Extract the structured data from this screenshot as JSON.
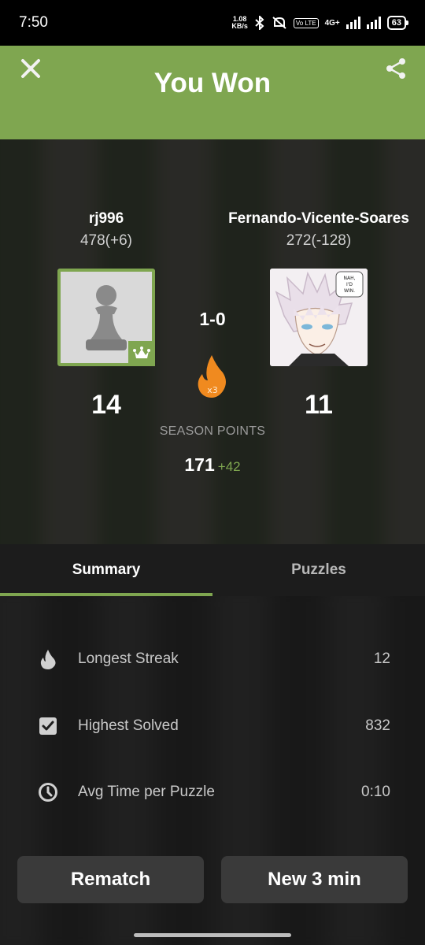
{
  "status_bar": {
    "time": "7:50",
    "speed": "1.08",
    "speed_unit": "KB/s",
    "network": "4G+",
    "battery": "63"
  },
  "header": {
    "title": "You Won"
  },
  "players": {
    "left": {
      "name": "rj996",
      "rating": "478(+6)",
      "points": "14"
    },
    "right": {
      "name": "Fernando-Vicente-Soares",
      "rating": "272(-128)",
      "points": "11"
    }
  },
  "match": {
    "score": "1-0",
    "streak_multiplier": "x3"
  },
  "season": {
    "label": "SEASON POINTS",
    "total": "171",
    "gain": "+42"
  },
  "tabs": [
    {
      "label": "Summary",
      "active": true
    },
    {
      "label": "Puzzles",
      "active": false
    }
  ],
  "stats": [
    {
      "icon": "flame-icon",
      "label": "Longest Streak",
      "value": "12"
    },
    {
      "icon": "checkbox-icon",
      "label": "Highest Solved",
      "value": "832"
    },
    {
      "icon": "clock-icon",
      "label": "Avg Time per Puzzle",
      "value": "0:10"
    }
  ],
  "buttons": {
    "rematch": "Rematch",
    "new_game": "New 3 min"
  },
  "colors": {
    "accent_green": "#7fa650",
    "flame_orange": "#f08a1f"
  }
}
